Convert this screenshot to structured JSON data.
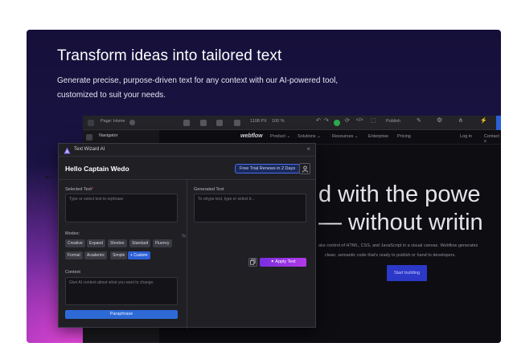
{
  "hero": {
    "title": "Transform ideas into tailored text",
    "subtitle": "Generate precise, purpose-driven text for any context with our AI-powered tool, customized to suit your needs."
  },
  "editor_bg": {
    "toolbar": {
      "page_label": "Page: Home",
      "width": "1108 PX",
      "zoom": "100 %",
      "publish": "Publish"
    },
    "navigator_label": "Navigator",
    "site_nav": {
      "logo": "webflow",
      "items": [
        "Product ⌄",
        "Solutions ⌄",
        "Resources ⌄",
        "Enterprise",
        "Pricing"
      ],
      "login": "Log in",
      "contact": "Contact s"
    },
    "hero_line1": "d with the powe",
    "hero_line2": "— without writin",
    "paragraph_line1": "ake control of HTML, CSS, and JavaScript in a visual canvas. Webflow generates",
    "paragraph_line2": "clean, semantic code that's ready to publish or hand to developers.",
    "start_button": "Start building"
  },
  "dialog": {
    "title": "Text Wizard AI",
    "close": "×",
    "greeting": "Hello Captain Wedo",
    "trial_badge": "Free Trial Renews in 2 Days",
    "selected_label": "Selected Text",
    "selected_placeholder": "Type or select text to rephrase",
    "generated_label": "Generated Text",
    "generated_placeholder": "To retype text, type or select it...",
    "modes_label": "Modes:",
    "modes": [
      "Creative",
      "Expand",
      "Shorten",
      "Standard",
      "Fluency",
      "Formal",
      "Academic",
      "Simple",
      "+ Custom"
    ],
    "active_mode": "+ Custom",
    "context_label": "Context",
    "context_placeholder": "Give AI context about what you want to change.",
    "paraphrase_button": "Paraphrase",
    "apply_button": "Apply Text"
  },
  "colors": {
    "accent_blue": "#2d6ad6",
    "apply_purple": "#9a34e4",
    "dialog_bg": "#1f1f24"
  }
}
